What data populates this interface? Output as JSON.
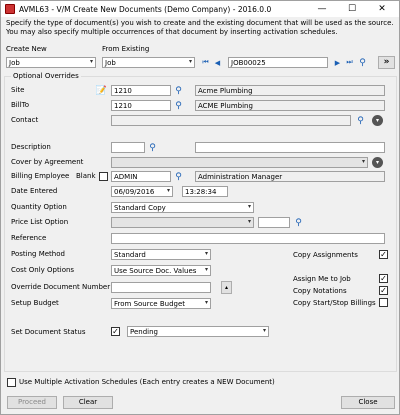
{
  "window": {
    "title": "AVML63 - V/M Create New Documents (Demo Company) - 2016.0.0",
    "min": "—",
    "max": "☐",
    "close": "✕"
  },
  "instructions": "Specify the type of document(s) you wish to create and the existing document that will be used as the source. You may also specify multiple occurrences of that document by inserting activation schedules.",
  "create_new": {
    "label": "Create New",
    "value": "Job"
  },
  "from_existing": {
    "label": "From Existing",
    "value": "Job",
    "document": "JOB00025"
  },
  "overrides": {
    "title": "Optional Overrides"
  },
  "site": {
    "label": "Site",
    "code": "1210",
    "name": "Acme Plumbing"
  },
  "billto": {
    "label": "BillTo",
    "code": "1210",
    "name": "ACME Plumbing"
  },
  "contact": {
    "label": "Contact",
    "value": ""
  },
  "description": {
    "label": "Description",
    "code": "",
    "text": ""
  },
  "cover": {
    "label": "Cover by Agreement",
    "value": ""
  },
  "billing_employee": {
    "label": "Billing Employee",
    "blank_label": "Blank",
    "code": "ADMIN",
    "name": "Administration Manager"
  },
  "date_entered": {
    "label": "Date Entered",
    "date": "06/09/2016",
    "time": "13:28:34"
  },
  "quantity": {
    "label": "Quantity Option",
    "value": "Standard Copy"
  },
  "price_list": {
    "label": "Price List Option",
    "value": "",
    "extra": ""
  },
  "reference": {
    "label": "Reference",
    "value": ""
  },
  "posting": {
    "label": "Posting Method",
    "value": "Standard"
  },
  "cost_only": {
    "label": "Cost Only Options",
    "value": "Use Source Doc. Values"
  },
  "override_doc": {
    "label": "Override Document Number",
    "value": ""
  },
  "setup_budget": {
    "label": "Setup Budget",
    "value": "From Source Budget"
  },
  "copy_assignments": {
    "label": "Copy Assignments",
    "checked": true
  },
  "assign_me": {
    "label": "Assign Me to Job",
    "checked": true
  },
  "copy_notations": {
    "label": "Copy Notations",
    "checked": true
  },
  "copy_startstop": {
    "label": "Copy Start/Stop Billings",
    "checked": false
  },
  "status": {
    "label": "Set Document Status",
    "checked": true,
    "value": "Pending"
  },
  "multi": {
    "label": "Use Multiple Activation Schedules (Each entry creates a NEW Document)",
    "checked": false
  },
  "buttons": {
    "proceed": "Proceed",
    "clear": "Clear",
    "close": "Close"
  },
  "nav": {
    "first": "⏮",
    "prev": "◀",
    "next": "▶",
    "last": "⏭",
    "go": "»"
  },
  "icons": {
    "check": "✓",
    "down": "▾",
    "zoom": "⚲",
    "up": "▴"
  }
}
